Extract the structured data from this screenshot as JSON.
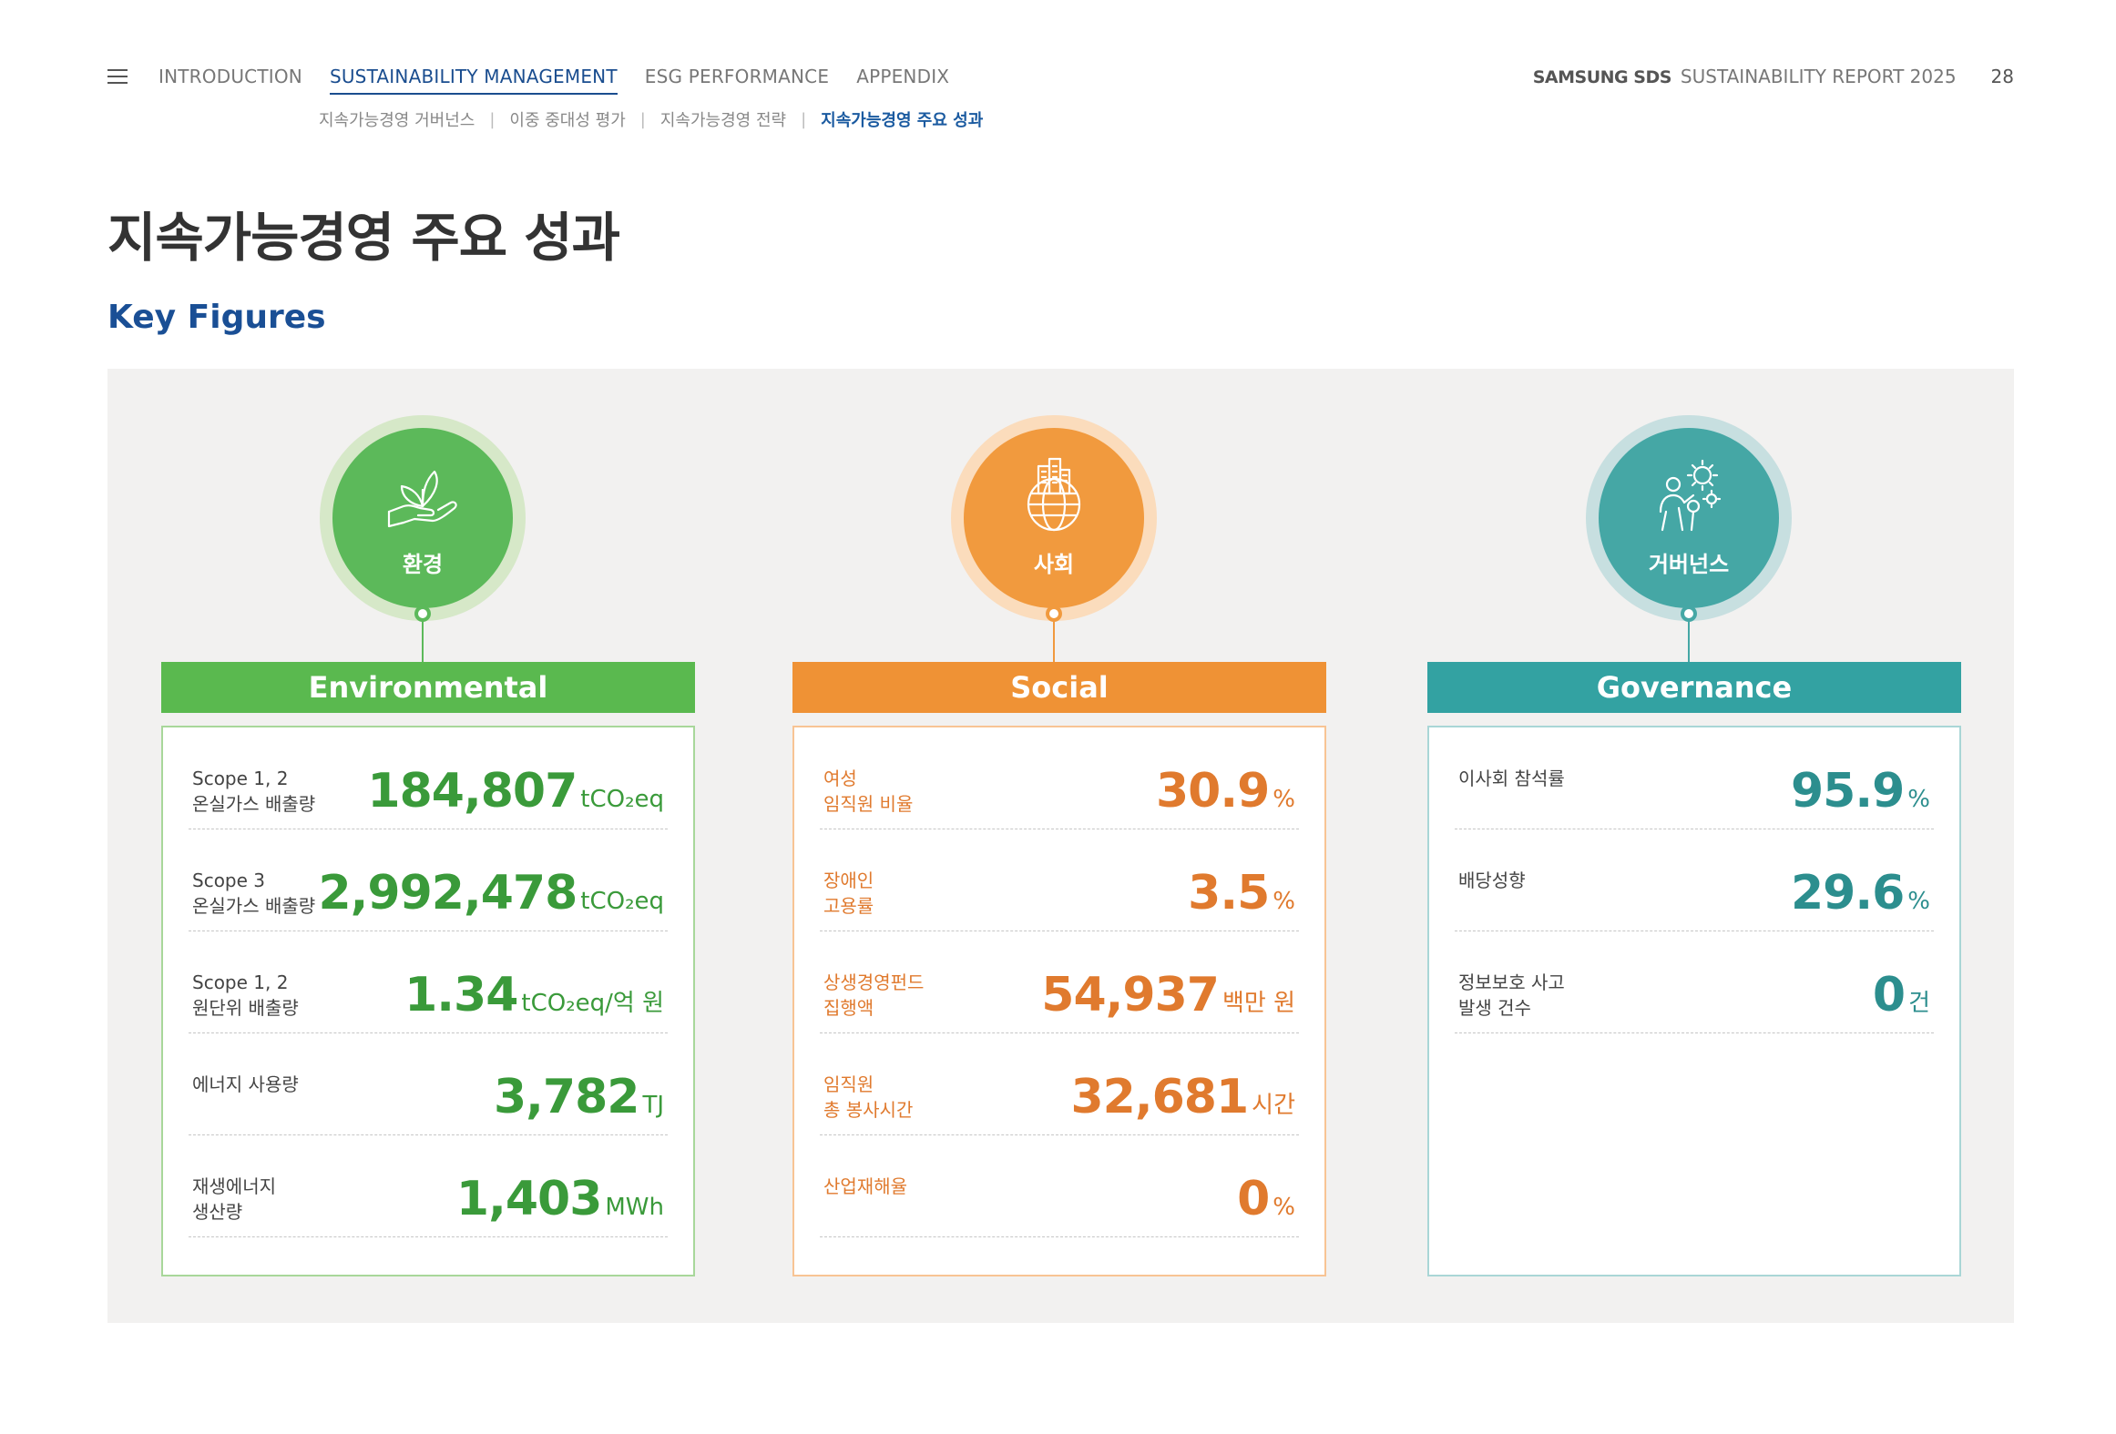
{
  "header": {
    "nav": [
      {
        "label": "INTRODUCTION",
        "active": false
      },
      {
        "label": "SUSTAINABILITY MANAGEMENT",
        "active": true
      },
      {
        "label": "ESG PERFORMANCE",
        "active": false
      },
      {
        "label": "APPENDIX",
        "active": false
      }
    ],
    "subnav": [
      {
        "label": "지속가능경영 거버넌스",
        "active": false
      },
      {
        "label": "이중 중대성 평가",
        "active": false
      },
      {
        "label": "지속가능경영 전략",
        "active": false
      },
      {
        "label": "지속가능경영 주요 성과",
        "active": true
      }
    ],
    "subnav_separator": "|",
    "brand": "SAMSUNG SDS",
    "report_title": "SUSTAINABILITY REPORT 2025",
    "page_number": "28"
  },
  "page_title": "지속가능경영 주요 성과",
  "section_title": "Key Figures",
  "pillars": {
    "environmental": {
      "circle_label": "환경",
      "icon": "hand-leaf-icon",
      "heading": "Environmental",
      "color": "#5ab94f",
      "rows": [
        {
          "label_line1": "Scope 1, 2",
          "label_line2": "온실가스 배출량",
          "value": "184,807",
          "unit": "tCO₂eq"
        },
        {
          "label_line1": "Scope 3",
          "label_line2": "온실가스 배출량",
          "value": "2,992,478",
          "unit": "tCO₂eq"
        },
        {
          "label_line1": "Scope 1, 2",
          "label_line2": "원단위 배출량",
          "value": "1.34",
          "unit": "tCO₂eq/억 원"
        },
        {
          "label_line1": "에너지 사용량",
          "label_line2": "",
          "value": "3,782",
          "unit": "TJ"
        },
        {
          "label_line1": "재생에너지",
          "label_line2": "생산량",
          "value": "1,403",
          "unit": "MWh"
        }
      ]
    },
    "social": {
      "circle_label": "사회",
      "icon": "globe-buildings-icon",
      "heading": "Social",
      "color": "#ef9235",
      "rows": [
        {
          "label_line1": "여성",
          "label_line2": "임직원 비율",
          "value": "30.9",
          "unit": "%"
        },
        {
          "label_line1": "장애인",
          "label_line2": "고용률",
          "value": "3.5",
          "unit": "%"
        },
        {
          "label_line1": "상생경영펀드",
          "label_line2": "집행액",
          "value": "54,937",
          "unit": "백만 원"
        },
        {
          "label_line1": "임직원",
          "label_line2": "총 봉사시간",
          "value": "32,681",
          "unit": "시간"
        },
        {
          "label_line1": "산업재해율",
          "label_line2": "",
          "value": "0",
          "unit": "%"
        }
      ]
    },
    "governance": {
      "circle_label": "거버넌스",
      "icon": "people-gears-icon",
      "heading": "Governance",
      "color": "#33a2a2",
      "rows": [
        {
          "label_line1": "이사회 참석률",
          "label_line2": "",
          "value": "95.9",
          "unit": "%"
        },
        {
          "label_line1": "배당성향",
          "label_line2": "",
          "value": "29.6",
          "unit": "%"
        },
        {
          "label_line1": "정보보호 사고",
          "label_line2": "발생 건수",
          "value": "0",
          "unit": "건"
        }
      ]
    }
  }
}
